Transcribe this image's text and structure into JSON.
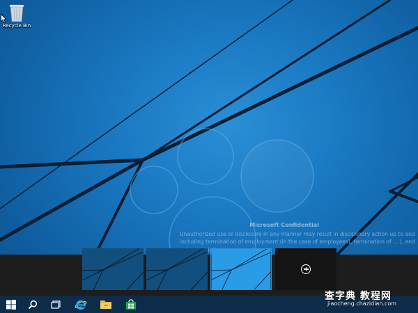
{
  "desktop": {
    "recycle_bin_label": "Recycle Bin"
  },
  "confidential": {
    "title": "Microsoft Confidential",
    "body": "Unauthorized use or disclosure in any manner may result in disciplinary action up to and including termination of employment (in the case of employees), termination of ... ), and potential civil and"
  },
  "task_view": {
    "desktops": [
      {
        "name": "desktop-1"
      },
      {
        "name": "desktop-2"
      },
      {
        "name": "desktop-3"
      }
    ],
    "add_desktop_icon": "plus-circle-icon"
  },
  "taskbar": {
    "items": [
      "windows-logo-icon",
      "search-icon",
      "task-view-icon",
      "internet-explorer-icon",
      "file-explorer-icon",
      "store-icon"
    ]
  },
  "watermark": {
    "main": "查字典 教程网",
    "sub": "jiaocheng.chazidian.com"
  },
  "colors": {
    "taskbar": "#0c2c4a",
    "task_view_strip": "#1d1d1d",
    "selected_border": "#2d8fe0",
    "store_green": "#1ba84a",
    "start_blue": "#ffffff"
  }
}
